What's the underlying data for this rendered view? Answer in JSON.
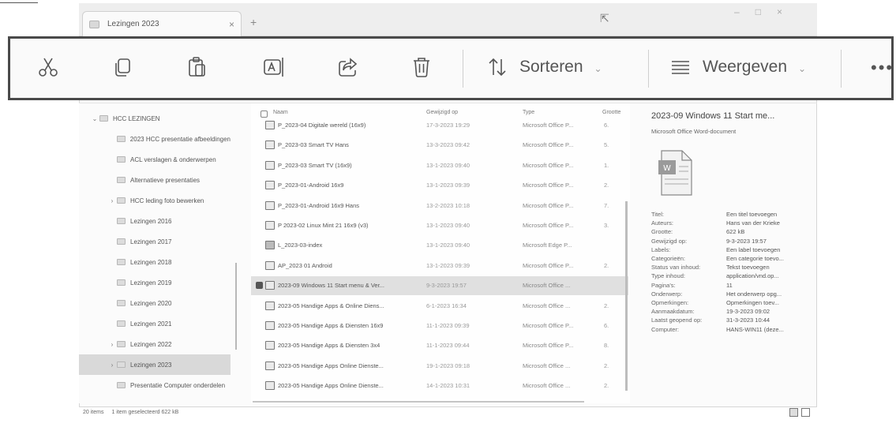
{
  "tab": {
    "title": "Lezingen 2023",
    "close": "×",
    "new_tab": "+"
  },
  "window_controls": {
    "minimize": "–",
    "maximize": "□",
    "close": "×"
  },
  "command_bar": {
    "icons": [
      "cut-icon",
      "copy-icon",
      "paste-icon",
      "rename-icon",
      "share-icon",
      "delete-icon"
    ],
    "sort_label": "Sorteren",
    "view_label": "Weergeven",
    "chevron": "⌄",
    "more": "•••"
  },
  "nav": {
    "items": [
      {
        "label": "HCC LEZINGEN",
        "twisty": "⌄"
      },
      {
        "label": "2023 HCC presentatie afbeeldingen",
        "twisty": ""
      },
      {
        "label": "ACL verslagen & onderwerpen",
        "twisty": ""
      },
      {
        "label": "Alternatieve presentaties",
        "twisty": ""
      },
      {
        "label": "HCC leding foto bewerken",
        "twisty": "›"
      },
      {
        "label": "Lezingen 2016",
        "twisty": ""
      },
      {
        "label": "Lezingen 2017",
        "twisty": ""
      },
      {
        "label": "Lezingen 2018",
        "twisty": ""
      },
      {
        "label": "Lezingen 2019",
        "twisty": ""
      },
      {
        "label": "Lezingen 2020",
        "twisty": ""
      },
      {
        "label": "Lezingen 2021",
        "twisty": ""
      },
      {
        "label": "Lezingen 2022",
        "twisty": "›"
      },
      {
        "label": "Lezingen 2023",
        "twisty": "›"
      },
      {
        "label": "Presentatie Computer onderdelen",
        "twisty": ""
      }
    ]
  },
  "files": {
    "columns": {
      "name": "Naam",
      "date": "Gewijzigd op",
      "type": "Type",
      "size": "Grootte"
    },
    "rows": [
      {
        "name": "P_2023-04 Digitale wereld (16x9)",
        "date": "17-3-2023 19:29",
        "type": "Microsoft Office P...",
        "size": "6."
      },
      {
        "name": "P_2023-03 Smart TV Hans",
        "date": "13-3-2023 09:42",
        "type": "Microsoft Office P...",
        "size": "5."
      },
      {
        "name": "P_2023-03 Smart TV (16x9)",
        "date": "13-1-2023 09:40",
        "type": "Microsoft Office P...",
        "size": "1."
      },
      {
        "name": "P_2023-01-Android 16x9",
        "date": "13-1-2023 09:39",
        "type": "Microsoft Office P...",
        "size": "2."
      },
      {
        "name": "P_2023-01-Android 16x9 Hans",
        "date": "13-2-2023 10:18",
        "type": "Microsoft Office P...",
        "size": "7."
      },
      {
        "name": "P 2023-02 Linux Mint 21 16x9 (v3)",
        "date": "13-1-2023 09:40",
        "type": "Microsoft Office P...",
        "size": "3."
      },
      {
        "name": "L_2023-03-index",
        "date": "13-1-2023 09:40",
        "type": "Microsoft Edge P...",
        "size": ""
      },
      {
        "name": "AP_2023 01 Android",
        "date": "13-1-2023 09:39",
        "type": "Microsoft Office P...",
        "size": "2."
      },
      {
        "name": "2023-09 Windows 11 Start menu & Ver...",
        "date": "9-3-2023 19:57",
        "type": "Microsoft Office ...",
        "size": ""
      },
      {
        "name": "2023-05 Handige Apps & Online Diens...",
        "date": "6-1-2023 16:34",
        "type": "Microsoft Office ...",
        "size": "2."
      },
      {
        "name": "2023-05 Handige Apps & Diensten 16x9",
        "date": "11-1-2023 09:39",
        "type": "Microsoft Office P...",
        "size": "6."
      },
      {
        "name": "2023-05 Handige Apps & Diensten 3x4",
        "date": "11-1-2023 09:44",
        "type": "Microsoft Office P...",
        "size": "8."
      },
      {
        "name": "2023-05 Handige Apps Online Dienste...",
        "date": "19-1-2023 09:18",
        "type": "Microsoft Office ...",
        "size": "2."
      },
      {
        "name": "2023-05 Handige Apps Online Dienste...",
        "date": "14-1-2023 10:31",
        "type": "Microsoft Office ...",
        "size": "2."
      }
    ]
  },
  "details": {
    "title": "2023-09 Windows 11 Start me...",
    "subtitle": "Microsoft Office Word-document",
    "props": [
      {
        "label": "Titel:",
        "value": "Een titel toevoegen"
      },
      {
        "label": "Auteurs:",
        "value": "Hans van der Krieke"
      },
      {
        "label": "Grootte:",
        "value": "622 kB"
      },
      {
        "label": "Gewijzigd op:",
        "value": "9-3-2023 19:57"
      },
      {
        "label": "Labels:",
        "value": "Een label toevoegen"
      },
      {
        "label": "Categorieën:",
        "value": "Een categorie toevo..."
      },
      {
        "label": "Status van inhoud:",
        "value": "Tekst toevoegen"
      },
      {
        "label": "Type inhoud:",
        "value": "application/vnd.op..."
      },
      {
        "label": "Pagina's:",
        "value": "11"
      },
      {
        "label": "Onderwerp:",
        "value": "Het onderwerp opg..."
      },
      {
        "label": "Opmerkingen:",
        "value": "Opmerkingen toev..."
      },
      {
        "label": "Aanmaakdatum:",
        "value": "19-3-2023 09:02"
      },
      {
        "label": "Laatst geopend op:",
        "value": "31-3-2023 10:44"
      },
      {
        "label": "Computer:",
        "value": "HANS-WIN11 (deze..."
      }
    ]
  },
  "status": {
    "count": "20 items",
    "selection": "1 item geselecteerd 622 kB"
  }
}
